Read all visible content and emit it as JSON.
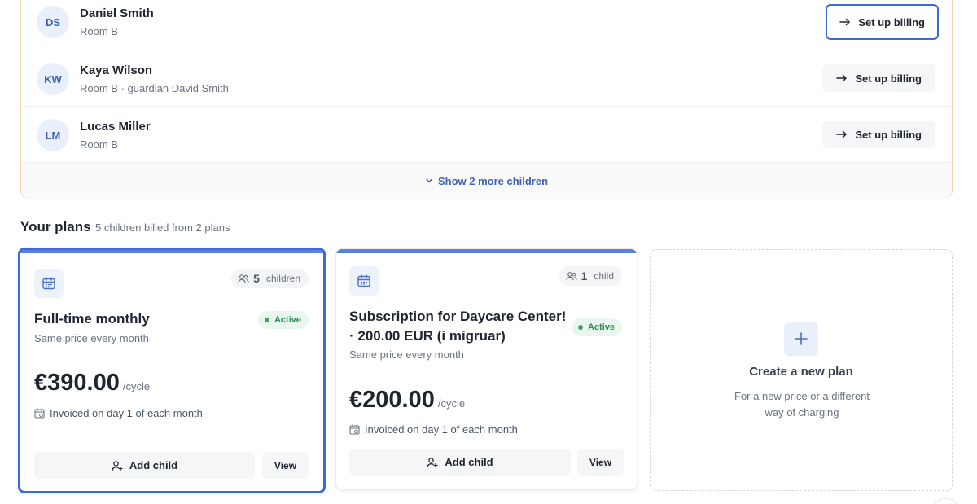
{
  "children": [
    {
      "initials": "DS",
      "name": "Daniel Smith",
      "detail": "Room B",
      "action": "Set up billing"
    },
    {
      "initials": "KW",
      "name": "Kaya Wilson",
      "detail": "Room B · guardian David Smith",
      "action": "Set up billing"
    },
    {
      "initials": "LM",
      "name": "Lucas Miller",
      "detail": "Room B",
      "action": "Set up billing"
    }
  ],
  "show_more": "Show 2 more children",
  "plans_section": {
    "title": "Your plans",
    "subtitle": "5 children billed from 2 plans"
  },
  "plans": [
    {
      "count": "5",
      "count_label": "children",
      "name": "Full-time monthly",
      "pricing_type": "Same price every month",
      "status": "Active",
      "price": "€390.00",
      "cycle": "/cycle",
      "invoice": "Invoiced on day 1 of each month",
      "add_label": "Add child",
      "view_label": "View"
    },
    {
      "count": "1",
      "count_label": "child",
      "name": "Subscription for Daycare Center! · 200.00 EUR (i migruar)",
      "pricing_type": "Same price every month",
      "status": "Active",
      "price": "€200.00",
      "cycle": "/cycle",
      "invoice": "Invoiced on day 1 of each month",
      "add_label": "Add child",
      "view_label": "View"
    }
  ],
  "create_plan": {
    "title": "Create a new plan",
    "description": "For a new price or a different way of charging"
  },
  "colors": {
    "accent": "#3e6ad8",
    "avatar_text": "#3d63b8",
    "active_green": "#2f8a4f",
    "panel_border": "#f3d7b3"
  }
}
